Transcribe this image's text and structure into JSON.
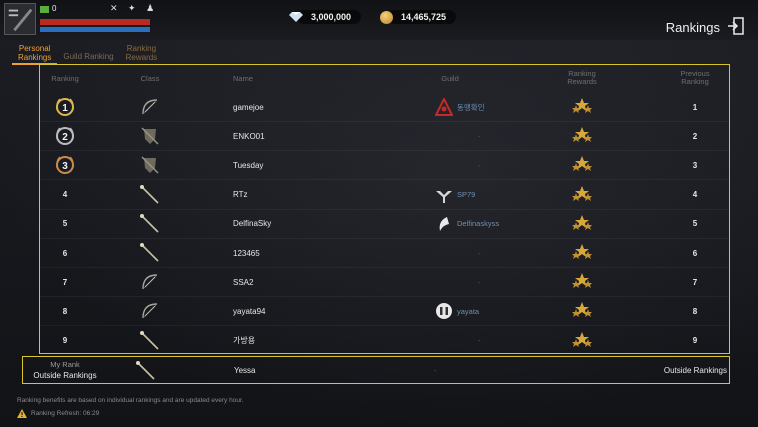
{
  "player": {
    "level_text": "0",
    "status_icons": "✕ ✦ ♟"
  },
  "currency": {
    "gems": "3,000,000",
    "gold": "14,465,725"
  },
  "header": {
    "title": "Rankings"
  },
  "tabs": [
    {
      "label_line1": "Personal",
      "label_line2": "Rankings"
    },
    {
      "label_line1": "Guild Ranking",
      "label_line2": ""
    },
    {
      "label_line1": "Ranking",
      "label_line2": "Rewards"
    }
  ],
  "table": {
    "columns": {
      "ranking": "Ranking",
      "class": "Class",
      "name": "Name",
      "guild": "Guild",
      "rewards_line1": "Ranking",
      "rewards_line2": "Rewards",
      "previous_line1": "Previous",
      "previous_line2": "Ranking"
    },
    "rows": [
      {
        "rank": "1",
        "class_icon": "bow-icon",
        "name": "gamejoe",
        "guild": "동맹확인",
        "prev": "1"
      },
      {
        "rank": "2",
        "class_icon": "shield-icon",
        "name": "ENKO01",
        "guild": "-",
        "prev": "2"
      },
      {
        "rank": "3",
        "class_icon": "shield-icon",
        "name": "Tuesday",
        "guild": "-",
        "prev": "3"
      },
      {
        "rank": "4",
        "class_icon": "staff-icon",
        "name": "RTz",
        "guild": "SP79",
        "prev": "4"
      },
      {
        "rank": "5",
        "class_icon": "staff-icon",
        "name": "DelfinaSky",
        "guild": "Delfinaskyss",
        "prev": "5"
      },
      {
        "rank": "6",
        "class_icon": "staff-icon",
        "name": "123465",
        "guild": "-",
        "prev": "6"
      },
      {
        "rank": "7",
        "class_icon": "bow-icon",
        "name": "SSA2",
        "guild": "-",
        "prev": "7"
      },
      {
        "rank": "8",
        "class_icon": "bow-icon",
        "name": "yayata94",
        "guild": "yayata",
        "prev": "8"
      },
      {
        "rank": "9",
        "class_icon": "staff-icon",
        "name": "가방용",
        "guild": "-",
        "prev": "9"
      }
    ]
  },
  "my_rank": {
    "label": "My Rank",
    "rank_text": "Outside Rankings",
    "name": "Yessa",
    "guild": "-",
    "prev": "Outside Rankings"
  },
  "footer": {
    "note": "Ranking benefits are based on individual rankings and are updated every hour.",
    "refresh": "Ranking Refresh: 06:29"
  },
  "colors": {
    "accent_tab": "#f0a030",
    "highlight_border": "#d9c42a",
    "guild_text": "#6e8fb0",
    "reward_gold": "#d8a83a"
  }
}
